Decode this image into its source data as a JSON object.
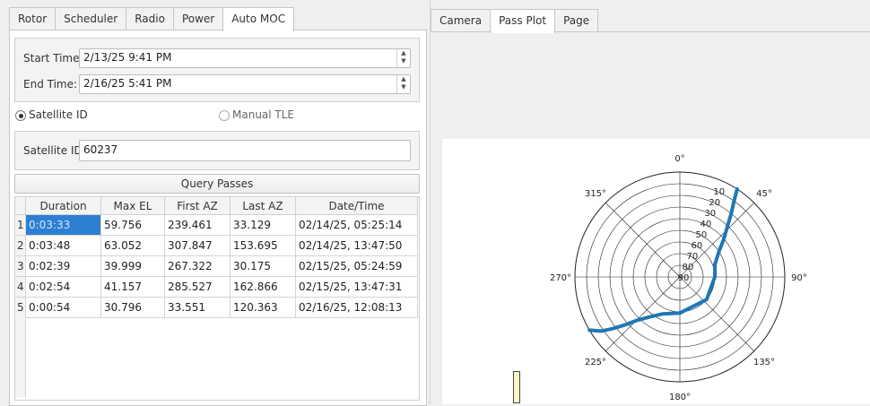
{
  "left_tabs": [
    "Rotor",
    "Scheduler",
    "Radio",
    "Power",
    "Auto MOC"
  ],
  "left_active": "Auto MOC",
  "right_tabs": [
    "Camera",
    "Pass Plot",
    "Page"
  ],
  "right_active": "Pass Plot",
  "time_group": {
    "start_label": "Start Time:",
    "start_value": "2/13/25 9:41 PM",
    "end_label": "End Time:",
    "end_value": "2/16/25 5:41 PM"
  },
  "mode": {
    "satellite_id_label": "Satellite ID",
    "manual_tle_label": "Manual TLE",
    "selected": "Satellite ID"
  },
  "sat_group": {
    "label": "Satellite ID:",
    "value": "60237"
  },
  "query_button": "Query Passes",
  "table": {
    "headers": [
      "Duration",
      "Max EL",
      "First AZ",
      "Last AZ",
      "Date/Time"
    ],
    "rows": [
      {
        "num": "1",
        "duration": "0:03:33",
        "max_el": "59.756",
        "first_az": "239.461",
        "last_az": "33.129",
        "datetime": "02/14/25, 05:25:14"
      },
      {
        "num": "2",
        "duration": "0:03:48",
        "max_el": "63.052",
        "first_az": "307.847",
        "last_az": "153.695",
        "datetime": "02/14/25, 13:47:50"
      },
      {
        "num": "3",
        "duration": "0:02:39",
        "max_el": "39.999",
        "first_az": "267.322",
        "last_az": "30.175",
        "datetime": "02/15/25, 05:24:59"
      },
      {
        "num": "4",
        "duration": "0:02:54",
        "max_el": "41.157",
        "first_az": "285.527",
        "last_az": "162.866",
        "datetime": "02/15/25, 13:47:31"
      },
      {
        "num": "5",
        "duration": "0:00:54",
        "max_el": "30.796",
        "first_az": "33.551",
        "last_az": "120.363",
        "datetime": "02/16/25, 12:08:13"
      }
    ],
    "selected_row": 0
  },
  "polar_plot": {
    "angle_labels": [
      "0°",
      "45°",
      "90°",
      "135°",
      "180°",
      "225°",
      "270°",
      "315°"
    ],
    "radial_labels": [
      "10",
      "20",
      "30",
      "40",
      "50",
      "60",
      "70",
      "80",
      "90"
    ],
    "series_color": "#1f77b4",
    "track": [
      {
        "az": 33.1,
        "el": 0
      },
      {
        "az": 35.5,
        "el": 10
      },
      {
        "az": 39.0,
        "el": 20
      },
      {
        "az": 43.0,
        "el": 30
      },
      {
        "az": 49.0,
        "el": 40
      },
      {
        "az": 57.0,
        "el": 50
      },
      {
        "az": 70.0,
        "el": 58
      },
      {
        "az": 90.0,
        "el": 60
      },
      {
        "az": 130.0,
        "el": 60
      },
      {
        "az": 180.0,
        "el": 59
      },
      {
        "az": 205.0,
        "el": 55
      },
      {
        "az": 217.0,
        "el": 47
      },
      {
        "az": 225.0,
        "el": 37
      },
      {
        "az": 229.0,
        "el": 27
      },
      {
        "az": 232.5,
        "el": 17
      },
      {
        "az": 235.5,
        "el": 8
      },
      {
        "az": 239.5,
        "el": 0
      }
    ]
  },
  "colors": {
    "selection": "#2d7fd1",
    "series": "#1f77b4"
  }
}
